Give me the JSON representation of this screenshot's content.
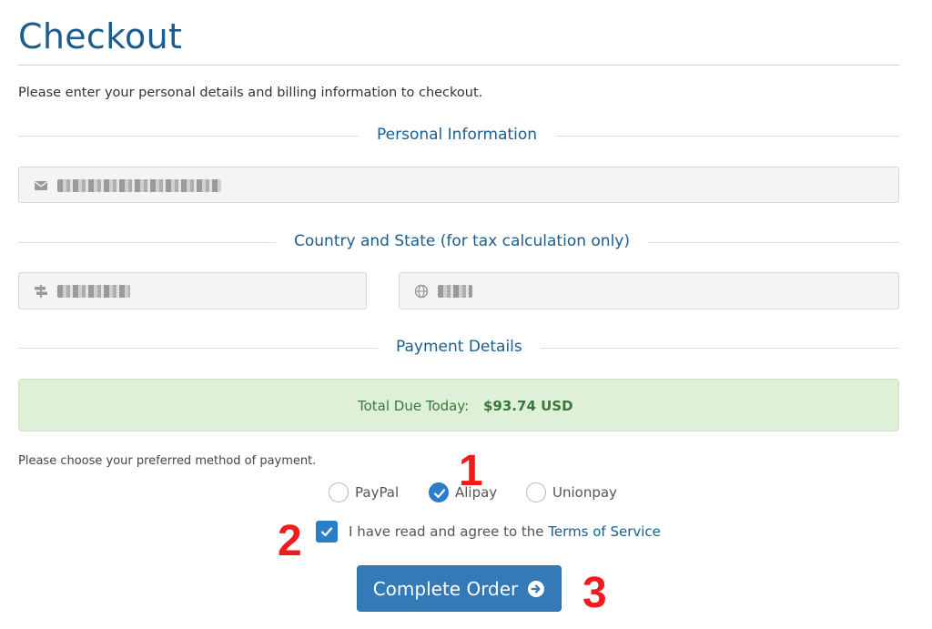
{
  "page": {
    "title": "Checkout",
    "intro": "Please enter your personal details and billing information to checkout."
  },
  "sections": {
    "personal": "Personal Information",
    "location": "Country and State (for tax calculation only)",
    "payment": "Payment Details"
  },
  "fields": {
    "email": {
      "icon": "envelope-icon",
      "value": ""
    },
    "state": {
      "icon": "signpost-icon",
      "value": ""
    },
    "country": {
      "icon": "globe-icon",
      "value": ""
    }
  },
  "total": {
    "label": "Total Due Today:",
    "amount": "$93.74 USD"
  },
  "payment": {
    "prompt": "Please choose your preferred method of payment.",
    "methods": [
      {
        "label": "PayPal",
        "checked": false
      },
      {
        "label": "Alipay",
        "checked": true
      },
      {
        "label": "Unionpay",
        "checked": false
      }
    ]
  },
  "agreement": {
    "checked": true,
    "text": "I have read and agree to the ",
    "link": "Terms of Service"
  },
  "button": {
    "label": "Complete Order",
    "icon": "arrow-circle-right-icon"
  },
  "annotations": [
    "1",
    "2",
    "3"
  ],
  "colors": {
    "accent": "#337ab7",
    "heading": "#1b5d8c",
    "success_bg": "#dff0d8",
    "success_text": "#3c763d",
    "annotation": "#ee1c1c"
  }
}
